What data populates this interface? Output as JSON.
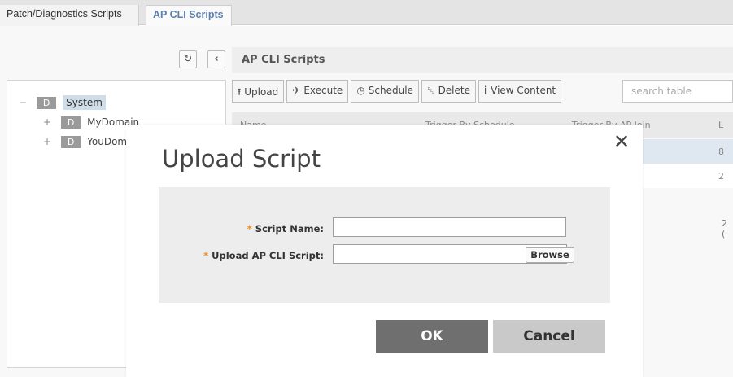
{
  "tabs": [
    {
      "label": "Patch/Diagnostics Scripts",
      "active": false
    },
    {
      "label": "AP CLI Scripts",
      "active": true
    }
  ],
  "tree": {
    "items": [
      {
        "toggle": "−",
        "badge": "D",
        "label": "System",
        "selected": true
      },
      {
        "toggle": "+",
        "badge": "D",
        "label": "MyDomain",
        "selected": false
      },
      {
        "toggle": "+",
        "badge": "D",
        "label": "YouDomain",
        "selected": false
      }
    ]
  },
  "panel": {
    "title": "AP CLI Scripts",
    "toolbar": [
      {
        "icon": "upload-icon",
        "glyph": "⭱",
        "label": "Upload"
      },
      {
        "icon": "rocket-icon",
        "glyph": "✈",
        "label": "Execute"
      },
      {
        "icon": "clock-icon",
        "glyph": "◷",
        "label": "Schedule"
      },
      {
        "icon": "trash-icon",
        "glyph": "␡",
        "label": "Delete"
      },
      {
        "icon": "info-icon",
        "glyph": "i",
        "label": "View Content"
      }
    ],
    "search_placeholder": "search table",
    "columns": [
      "Name",
      "Trigger By Schedule",
      "Trigger By AP Join",
      "L"
    ],
    "rows": [
      {
        "last": "8"
      },
      {
        "last": "2"
      }
    ],
    "summary": "2 ("
  },
  "modal": {
    "title": "Upload Script",
    "close_glyph": "✕",
    "fields": {
      "script_name": {
        "label": "Script Name:",
        "value": ""
      },
      "upload_script": {
        "label": "Upload AP CLI Script:",
        "value": "",
        "browse": "Browse"
      }
    },
    "required_mark": "*",
    "ok_label": "OK",
    "cancel_label": "Cancel"
  },
  "colors": {
    "accent": "#5b7fae",
    "required": "#f08a1c",
    "ok_button": "#6f6f6f",
    "cancel_button": "#c9c9c9"
  }
}
